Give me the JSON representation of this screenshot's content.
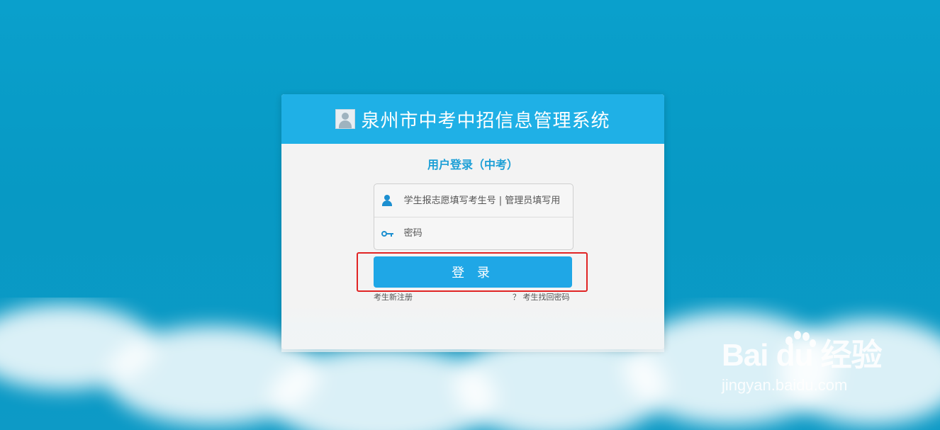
{
  "header": {
    "title": "泉州市中考中招信息管理系统"
  },
  "form": {
    "subtitle": "用户登录（中考）",
    "username_placeholder": "学生报志愿填写考生号 | 管理员填写用",
    "password_placeholder": "密码",
    "login_label": "登 录",
    "register_link": "考生新注册",
    "forgot_link": "？ 考生找回密码"
  },
  "watermark": {
    "logo_text": "Bai du 经验",
    "url": "jingyan.baidu.com"
  },
  "colors": {
    "header": "#1fb0e6",
    "button": "#1fa7e6",
    "background": "#0aa0cc",
    "highlight": "#e02424"
  }
}
